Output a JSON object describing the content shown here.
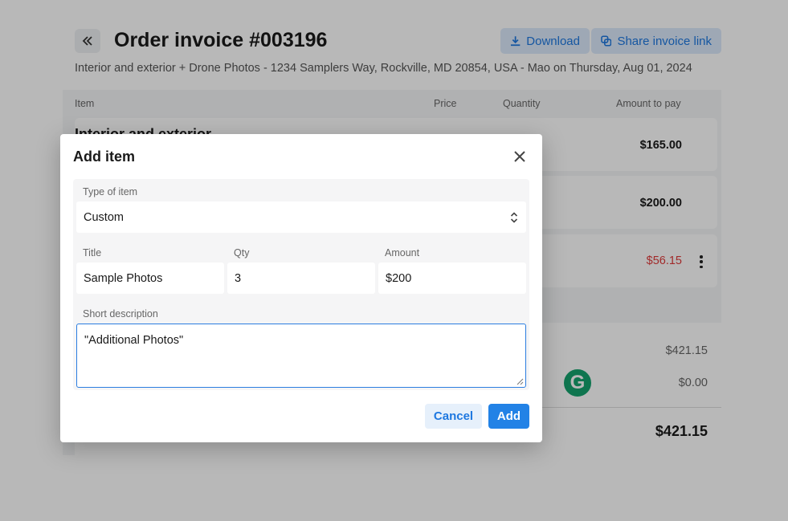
{
  "header": {
    "title": "Order invoice #003196",
    "subtitle": "Interior and exterior + Drone Photos - 1234 Samplers Way, Rockville, MD 20854, USA - Mao on Thursday, Aug 01, 2024",
    "download_label": "Download",
    "share_label": "Share invoice link"
  },
  "table": {
    "columns": [
      "Item",
      "Price",
      "Quantity",
      "Amount to pay"
    ],
    "first_row_title": "Interior and exterior",
    "rows": [
      {
        "amount": "$165.00"
      },
      {
        "amount": "$200.00"
      },
      {
        "amount": "$56.15"
      }
    ]
  },
  "summary": {
    "subtotal": "$421.15",
    "discount": "$0.00",
    "total": "$421.15"
  },
  "grammarly": {
    "letter": "G"
  },
  "modal": {
    "title": "Add item",
    "type_label": "Type of item",
    "type_value": "Custom",
    "title_label": "Title",
    "title_value": "Sample Photos",
    "qty_label": "Qty",
    "qty_value": "3",
    "amount_label": "Amount",
    "amount_value": "$200",
    "description_label": "Short description",
    "description_value": "\"Additional Photos\"",
    "cancel_label": "Cancel",
    "add_label": "Add"
  },
  "colors": {
    "accent": "#2282e6",
    "negative": "#e03b3b",
    "grammarly": "#15a36e"
  }
}
